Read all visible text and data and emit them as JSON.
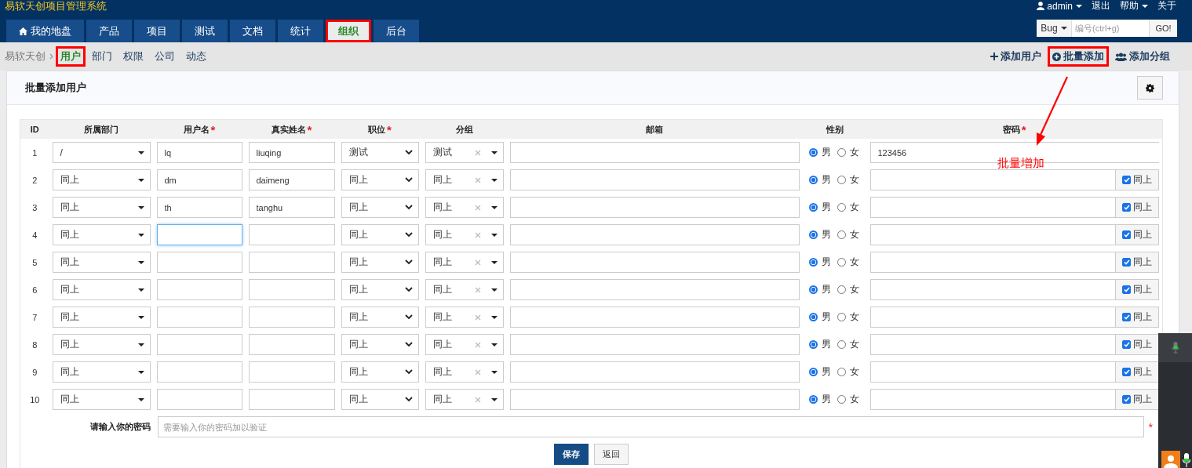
{
  "app": {
    "title": "易软天创项目管理系统"
  },
  "user_menu": {
    "user": "admin",
    "logout": "退出",
    "help": "帮助",
    "about": "关于"
  },
  "nav": {
    "tabs": [
      {
        "label": "我的地盘",
        "selected": false,
        "highlighted": false
      },
      {
        "label": "产品",
        "selected": false,
        "highlighted": false
      },
      {
        "label": "项目",
        "selected": false,
        "highlighted": false
      },
      {
        "label": "测试",
        "selected": false,
        "highlighted": false
      },
      {
        "label": "文档",
        "selected": false,
        "highlighted": false
      },
      {
        "label": "统计",
        "selected": false,
        "highlighted": false
      },
      {
        "label": "组织",
        "selected": true,
        "highlighted": true
      },
      {
        "label": "后台",
        "selected": false,
        "highlighted": false
      }
    ]
  },
  "search": {
    "type": "Bug",
    "placeholder": "编号(ctrl+g)",
    "button": "GO!"
  },
  "breadcrumb": {
    "root": "易软天创",
    "items": [
      {
        "label": "用户",
        "selected": true,
        "highlighted": true
      },
      {
        "label": "部门",
        "selected": false,
        "highlighted": false
      },
      {
        "label": "权限",
        "selected": false,
        "highlighted": false
      },
      {
        "label": "公司",
        "selected": false,
        "highlighted": false
      },
      {
        "label": "动态",
        "selected": false,
        "highlighted": false
      }
    ]
  },
  "actions": [
    {
      "label": "添加用户",
      "highlighted": false
    },
    {
      "label": "批量添加",
      "highlighted": true
    },
    {
      "label": "添加分组",
      "highlighted": false
    }
  ],
  "form": {
    "title": "批量添加用户",
    "columns": [
      {
        "label": "ID"
      },
      {
        "label": "所属部门"
      },
      {
        "label": "用户名",
        "mark": "*"
      },
      {
        "label": "真实姓名",
        "mark": "*"
      },
      {
        "label": "职位",
        "mark": "*"
      },
      {
        "label": "分组"
      },
      {
        "label": "邮箱"
      },
      {
        "label": "性别"
      },
      {
        "label": "密码",
        "mark": "*"
      }
    ],
    "rows": [
      {
        "id": "1",
        "dept": "/",
        "username": "lq",
        "realname": "liuqing",
        "position": "测试",
        "group": "测试",
        "focused": false,
        "genders": [
          {
            "label": "男",
            "selected": true
          },
          {
            "label": "女",
            "selected": false
          }
        ],
        "password": "123456"
      },
      {
        "id": "2",
        "dept": "同上",
        "username": "dm",
        "realname": "daimeng",
        "position": "同上",
        "group": "同上",
        "focused": false,
        "genders": [
          {
            "label": "男",
            "selected": true
          },
          {
            "label": "女",
            "selected": false
          }
        ],
        "same_as_above": {
          "label": "同上",
          "checked": true
        }
      },
      {
        "id": "3",
        "dept": "同上",
        "username": "th",
        "realname": "tanghu",
        "position": "同上",
        "group": "同上",
        "focused": false,
        "genders": [
          {
            "label": "男",
            "selected": true
          },
          {
            "label": "女",
            "selected": false
          }
        ],
        "same_as_above": {
          "label": "同上",
          "checked": true
        }
      },
      {
        "id": "4",
        "dept": "同上",
        "position": "同上",
        "group": "同上",
        "focused": true,
        "genders": [
          {
            "label": "男",
            "selected": true
          },
          {
            "label": "女",
            "selected": false
          }
        ],
        "same_as_above": {
          "label": "同上",
          "checked": true
        }
      },
      {
        "id": "5",
        "dept": "同上",
        "position": "同上",
        "group": "同上",
        "focused": false,
        "genders": [
          {
            "label": "男",
            "selected": true
          },
          {
            "label": "女",
            "selected": false
          }
        ],
        "same_as_above": {
          "label": "同上",
          "checked": true
        }
      },
      {
        "id": "6",
        "dept": "同上",
        "position": "同上",
        "group": "同上",
        "focused": false,
        "genders": [
          {
            "label": "男",
            "selected": true
          },
          {
            "label": "女",
            "selected": false
          }
        ],
        "same_as_above": {
          "label": "同上",
          "checked": true
        }
      },
      {
        "id": "7",
        "dept": "同上",
        "position": "同上",
        "group": "同上",
        "focused": false,
        "genders": [
          {
            "label": "男",
            "selected": true
          },
          {
            "label": "女",
            "selected": false
          }
        ],
        "same_as_above": {
          "label": "同上",
          "checked": true
        }
      },
      {
        "id": "8",
        "dept": "同上",
        "position": "同上",
        "group": "同上",
        "focused": false,
        "genders": [
          {
            "label": "男",
            "selected": true
          },
          {
            "label": "女",
            "selected": false
          }
        ],
        "same_as_above": {
          "label": "同上",
          "checked": true
        }
      },
      {
        "id": "9",
        "dept": "同上",
        "position": "同上",
        "group": "同上",
        "focused": false,
        "genders": [
          {
            "label": "男",
            "selected": true
          },
          {
            "label": "女",
            "selected": false
          }
        ],
        "same_as_above": {
          "label": "同上",
          "checked": true
        }
      },
      {
        "id": "10",
        "dept": "同上",
        "position": "同上",
        "group": "同上",
        "focused": false,
        "genders": [
          {
            "label": "男",
            "selected": true
          },
          {
            "label": "女",
            "selected": false
          }
        ],
        "same_as_above": {
          "label": "同上",
          "checked": true
        }
      }
    ],
    "verify": {
      "label": "请输入你的密码",
      "placeholder": "需要输入你的密码加以验证",
      "mark": "*"
    },
    "buttons": [
      {
        "label": "保存",
        "kind": "primary"
      },
      {
        "label": "返回",
        "kind": "default"
      }
    ]
  },
  "annotation": {
    "text": "批量增加"
  }
}
